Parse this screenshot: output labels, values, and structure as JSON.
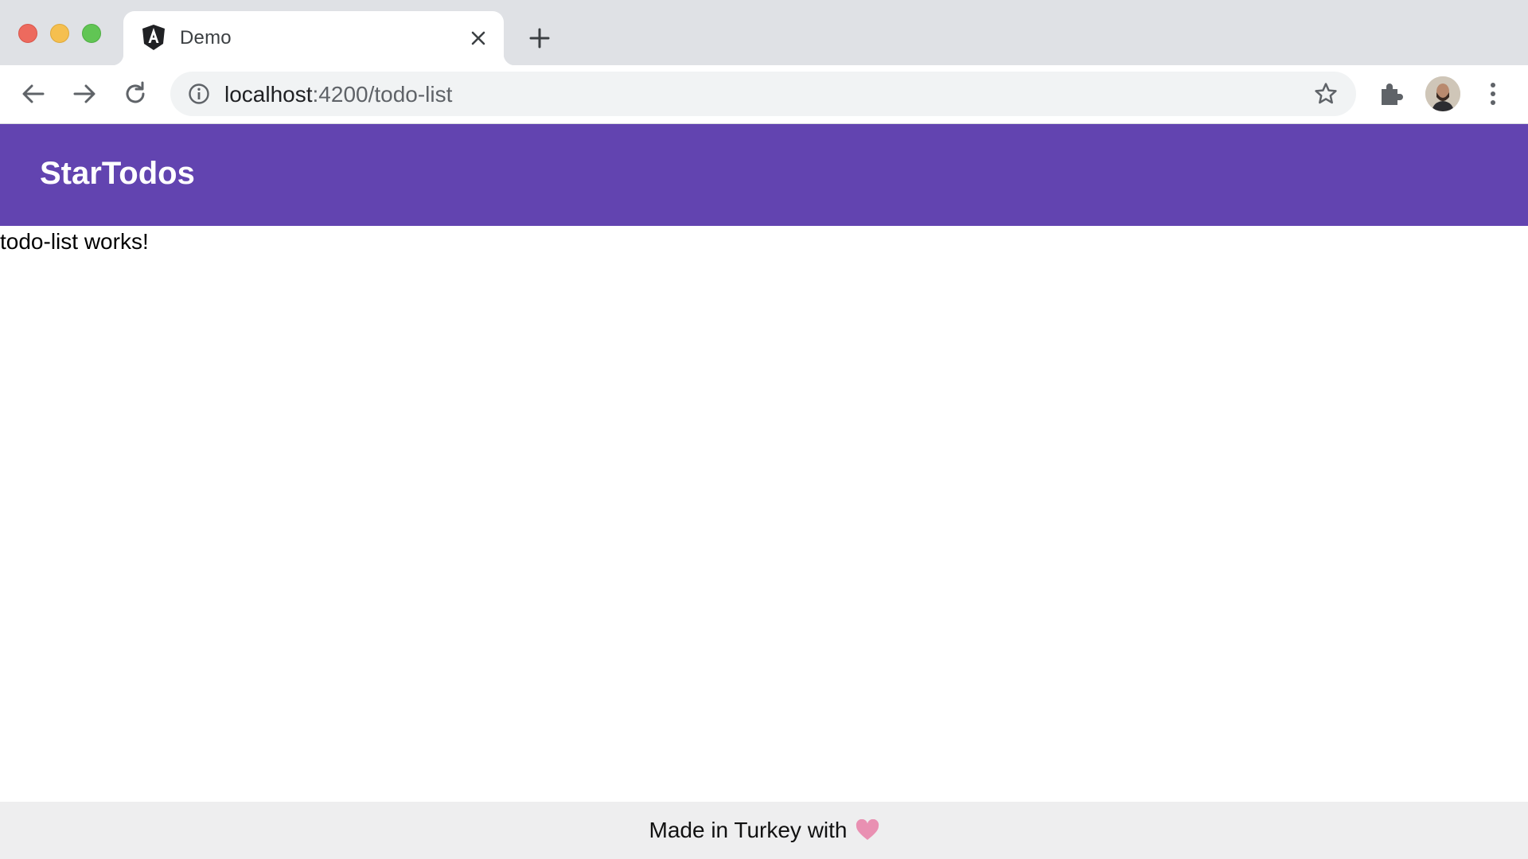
{
  "browser": {
    "tab": {
      "title": "Demo",
      "favicon": "angular-logo-icon"
    },
    "address_bar": {
      "host": "localhost",
      "path": ":4200/todo-list"
    },
    "icons": {
      "back": "back-arrow-icon",
      "forward": "forward-arrow-icon",
      "reload": "reload-icon",
      "site_info": "info-icon",
      "bookmark": "star-icon",
      "extensions": "puzzle-icon",
      "profile": "avatar",
      "menu": "kebab-menu-icon",
      "new_tab": "plus-icon",
      "close_tab": "close-icon"
    }
  },
  "app": {
    "brand": "StarTodos",
    "header_color": "#6244b0",
    "content_text": "todo-list works!",
    "footer": {
      "text": "Made in Turkey with",
      "icon": "heart-icon",
      "icon_color": "#e990b2"
    }
  }
}
